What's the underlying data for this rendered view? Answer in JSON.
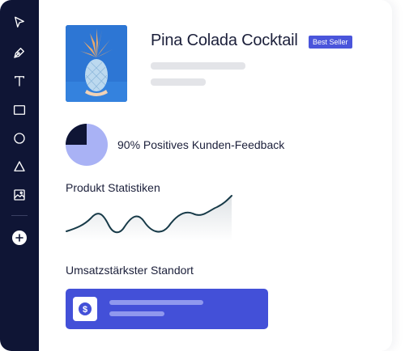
{
  "sidebar": {
    "tools": [
      {
        "name": "select",
        "icon": "cursor-arrow-icon"
      },
      {
        "name": "pen",
        "icon": "pen-tool-icon"
      },
      {
        "name": "text",
        "icon": "text-tool-icon"
      },
      {
        "name": "rectangle",
        "icon": "rectangle-tool-icon"
      },
      {
        "name": "ellipse",
        "icon": "circle-tool-icon"
      },
      {
        "name": "triangle",
        "icon": "triangle-tool-icon"
      },
      {
        "name": "image",
        "icon": "image-tool-icon"
      }
    ],
    "add_icon": "plus-circle-icon"
  },
  "product": {
    "title": "Pina Colada Cocktail",
    "badge": "Best Seller"
  },
  "feedback": {
    "text": "90% Positives Kunden-Feedback",
    "pie_colors": {
      "positive": "#a9b2f5",
      "rest": "#0f1535"
    }
  },
  "stats": {
    "heading": "Produkt Statistiken",
    "line_color": "#173a48"
  },
  "location": {
    "heading": "Umsatzstärkster Standort",
    "icon": "dollar-circle-icon",
    "card_color": "#4350d8"
  },
  "colors": {
    "sidebar": "#0f1535",
    "accent": "#4a55db"
  }
}
